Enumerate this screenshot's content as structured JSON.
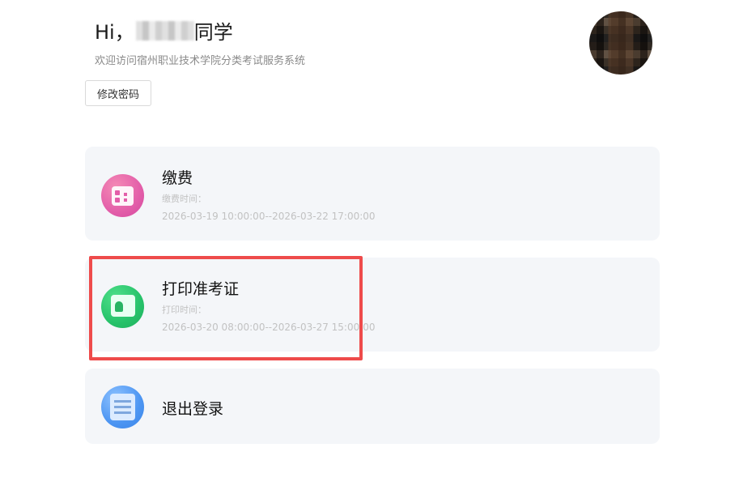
{
  "header": {
    "greeting_prefix": "Hi，",
    "greeting_suffix": "同学",
    "subtitle": "欢迎访问宿州职业技术学院分类考试服务系统",
    "change_password_label": "修改密码"
  },
  "cards": [
    {
      "title": "缴费",
      "time_label": "缴费时间：",
      "time_range": "2026-03-19 10:00:00--2026-03-22 17:00:00",
      "icon": "payment-card-icon",
      "icon_color": "#e35ea9"
    },
    {
      "title": "打印准考证",
      "time_label": "打印时间：",
      "time_range": "2026-03-20 08:00:00--2026-03-27 15:00:00",
      "icon": "id-card-icon",
      "icon_color": "#27c26a"
    },
    {
      "title": "退出登录",
      "icon": "document-list-icon",
      "icon_color": "#4c95f2"
    }
  ],
  "highlight_color": "#ee4b4b"
}
